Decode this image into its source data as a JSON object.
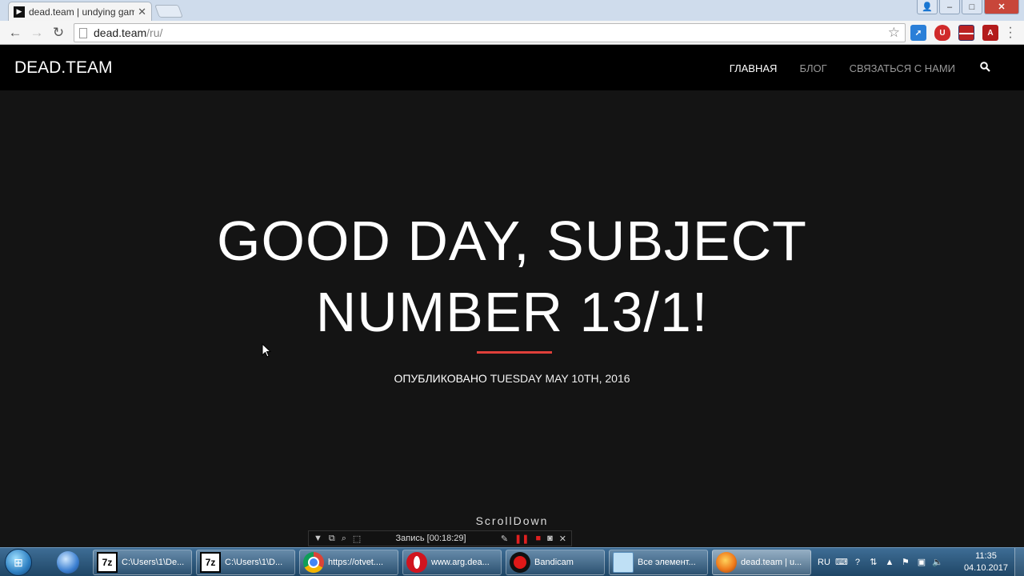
{
  "browser": {
    "tab_title": "dead.team | undying gam",
    "tab_close": "✕",
    "url_host": "dead.team",
    "url_path": "/ru/"
  },
  "site": {
    "brand": "DEAD.TEAM",
    "nav": [
      {
        "label": "ГЛАВНАЯ",
        "active": true
      },
      {
        "label": "БЛОГ",
        "active": false
      },
      {
        "label": "СВЯЗАТЬСЯ С НАМИ",
        "active": false
      }
    ],
    "hero_line1": "GOOD DAY, SUBJECT",
    "hero_line2": "NUMBER 13/1!",
    "published_prefix": "ОПУБЛИКОВАНО",
    "published_date": "TUESDAY MAY 10TH, 2016",
    "scroll_down": "ScrollDown",
    "accent_color": "#e0403a"
  },
  "recorder": {
    "status": "Запись [00:18:29]"
  },
  "taskbar": {
    "tasks": [
      {
        "icon": "7z-icon",
        "label": "C:\\Users\\1\\De..."
      },
      {
        "icon": "7z-icon",
        "label": "C:\\Users\\1\\D..."
      },
      {
        "icon": "chrome-icon",
        "label": "https://otvet...."
      },
      {
        "icon": "opera-icon",
        "label": "www.arg.dea..."
      },
      {
        "icon": "bandicam-icon",
        "label": "Bandicam"
      },
      {
        "icon": "control-panel-icon",
        "label": "Все элемент..."
      },
      {
        "icon": "firefox-icon",
        "label": "dead.team | u..."
      }
    ],
    "language": "RU",
    "time": "11:35",
    "date": "04.10.2017"
  }
}
